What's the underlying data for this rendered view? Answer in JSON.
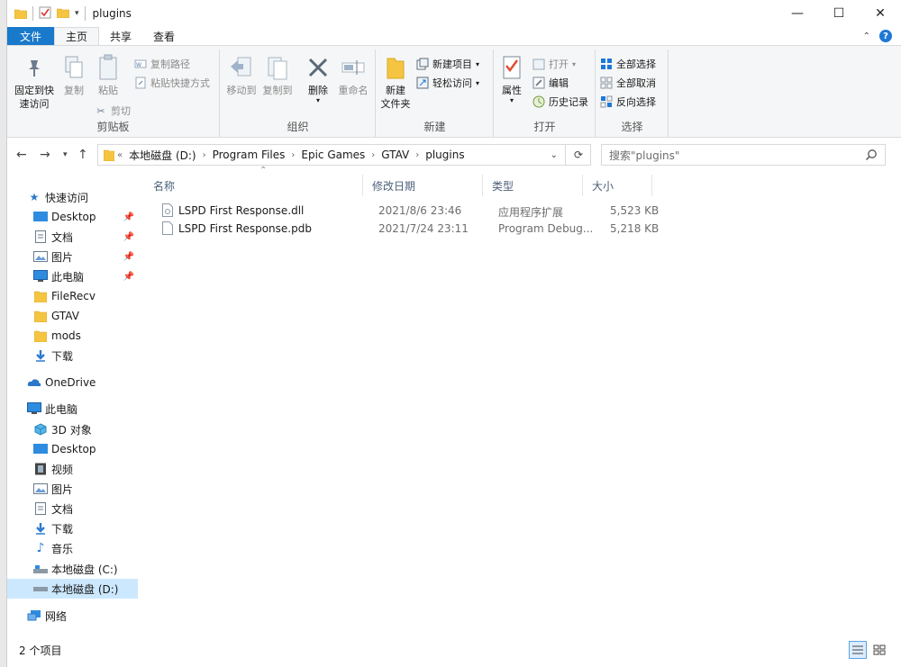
{
  "window": {
    "title": "plugins",
    "controls": {
      "minimize": "—",
      "maximize": "☐",
      "close": "✕"
    }
  },
  "tabs": [
    "文件",
    "主页",
    "共享",
    "查看"
  ],
  "ribbon": {
    "clipboard": {
      "label": "剪贴板",
      "pin_label_1": "固定到快",
      "pin_label_2": "速访问",
      "copy": "复制",
      "paste": "粘贴",
      "copy_path": "复制路径",
      "paste_shortcut": "粘贴快捷方式",
      "cut": "剪切"
    },
    "organize": {
      "label": "组织",
      "move_to": "移动到",
      "copy_to": "复制到",
      "delete": "删除",
      "rename": "重命名"
    },
    "new": {
      "label": "新建",
      "new_folder_1": "新建",
      "new_folder_2": "文件夹",
      "new_item": "新建项目",
      "easy_access": "轻松访问"
    },
    "open": {
      "label": "打开",
      "properties": "属性",
      "open": "打开",
      "edit": "编辑",
      "history": "历史记录"
    },
    "select": {
      "label": "选择",
      "select_all": "全部选择",
      "select_none": "全部取消",
      "invert": "反向选择"
    }
  },
  "address": {
    "overflow": "«",
    "crumbs": [
      "本地磁盘 (D:)",
      "Program Files",
      "Epic Games",
      "GTAV",
      "plugins"
    ],
    "search_placeholder": "搜索\"plugins\""
  },
  "nav": {
    "quick_access": "快速访问",
    "quick_items": [
      {
        "label": "Desktop",
        "pinned": true
      },
      {
        "label": "文档",
        "pinned": true
      },
      {
        "label": "图片",
        "pinned": true
      },
      {
        "label": "此电脑",
        "pinned": true
      },
      {
        "label": "FileRecv",
        "pinned": false
      },
      {
        "label": "GTAV",
        "pinned": false
      },
      {
        "label": "mods",
        "pinned": false
      },
      {
        "label": "下载",
        "pinned": false
      }
    ],
    "onedrive": "OneDrive",
    "this_pc": "此电脑",
    "pc_items": [
      "3D 对象",
      "Desktop",
      "视频",
      "图片",
      "文档",
      "下载",
      "音乐",
      "本地磁盘 (C:)",
      "本地磁盘 (D:)"
    ],
    "network": "网络"
  },
  "columns": {
    "name": "名称",
    "modified": "修改日期",
    "type": "类型",
    "size": "大小"
  },
  "files": [
    {
      "name": "LSPD First Response.dll",
      "modified": "2021/8/6 23:46",
      "type": "应用程序扩展",
      "size": "5,523 KB"
    },
    {
      "name": "LSPD First Response.pdb",
      "modified": "2021/7/24 23:11",
      "type": "Program Debug...",
      "size": "5,218 KB"
    }
  ],
  "status": {
    "count": "2 个项目"
  }
}
